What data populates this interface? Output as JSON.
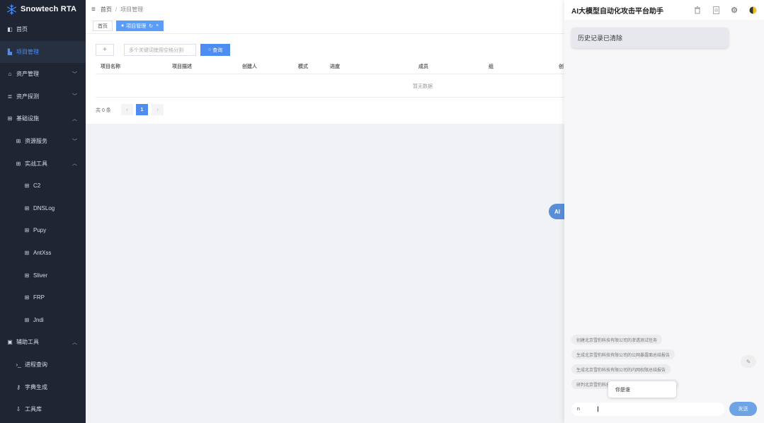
{
  "brand": {
    "name": "Snowtech RTA",
    "icon": "snowflake-icon"
  },
  "sidebar": {
    "items": [
      {
        "label": "首页",
        "icon": "dashboard-icon",
        "active": false,
        "expandable": false
      },
      {
        "label": "项目管理",
        "icon": "building-icon",
        "active": true,
        "expandable": false
      },
      {
        "label": "资产管理",
        "icon": "bank-icon",
        "active": false,
        "expandable": true,
        "expanded": false
      },
      {
        "label": "资产探测",
        "icon": "server-icon",
        "active": false,
        "expandable": true,
        "expanded": false
      },
      {
        "label": "基础设施",
        "icon": "grid-icon",
        "active": false,
        "expandable": true,
        "expanded": true
      },
      {
        "label": "资源服务",
        "icon": "grid-icon",
        "active": false,
        "expandable": true,
        "expanded": false
      },
      {
        "label": "实战工具",
        "icon": "grid-icon",
        "active": false,
        "expandable": true,
        "expanded": true
      },
      {
        "label": "C2",
        "icon": "grid-icon",
        "active": false,
        "expandable": false
      },
      {
        "label": "DNSLog",
        "icon": "grid-icon",
        "active": false,
        "expandable": false
      },
      {
        "label": "Pupy",
        "icon": "grid-icon",
        "active": false,
        "expandable": false
      },
      {
        "label": "AntXss",
        "icon": "grid-icon",
        "active": false,
        "expandable": false
      },
      {
        "label": "Sliver",
        "icon": "grid-icon",
        "active": false,
        "expandable": false
      },
      {
        "label": "FRP",
        "icon": "grid-icon",
        "active": false,
        "expandable": false
      },
      {
        "label": "Jndi",
        "icon": "grid-icon",
        "active": false,
        "expandable": false
      },
      {
        "label": "辅助工具",
        "icon": "toolbox-icon",
        "active": false,
        "expandable": true,
        "expanded": true
      },
      {
        "label": "进程查询",
        "icon": "terminal-icon",
        "active": false,
        "expandable": false
      },
      {
        "label": "字典生成",
        "icon": "key-icon",
        "active": false,
        "expandable": false
      },
      {
        "label": "工具库",
        "icon": "download-icon",
        "active": false,
        "expandable": false
      }
    ]
  },
  "topbar": {
    "breadcrumb_home": "首页",
    "breadcrumb_sep": "/",
    "breadcrumb_current": "项目管理"
  },
  "tabs": [
    {
      "label": "首页",
      "active": false
    },
    {
      "label": "项目管理",
      "active": true
    }
  ],
  "toolbar": {
    "add_label": "+",
    "search_placeholder": "多个关键词使用空格分割",
    "query_label": "查询"
  },
  "table": {
    "columns": [
      "项目名称",
      "项目描述",
      "创建人",
      "模式",
      "进度",
      "成员",
      "组",
      "创"
    ],
    "empty_text": "暂无数据"
  },
  "pagination": {
    "total_text": "共 0 条",
    "prev": "‹",
    "current_page": "1",
    "next": "›"
  },
  "ai_float": {
    "label": "AI"
  },
  "assistant": {
    "title": "AI大模型自动化攻击平台助手",
    "message": "历史记录已清除",
    "suggestions": [
      "创建北京雪豹科技有限公司的渗透测试任务",
      "生成北京雪豹科技有限公司的公网暴露面总结报告",
      "生成北京雪豹科技有限公司的内网权限总结报告",
      "研判北京雪豹科技"
    ],
    "tooltip": "你是谁",
    "input_value": "n",
    "send_label": "发送"
  }
}
